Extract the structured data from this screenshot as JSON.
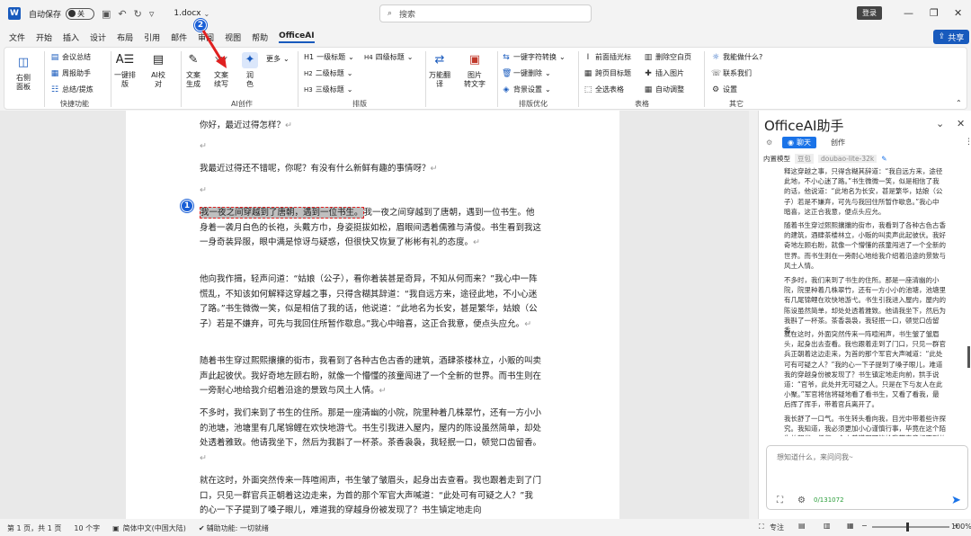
{
  "titlebar": {
    "logo": "W",
    "autosave_label": "自动保存",
    "autosave_state": "关",
    "doc_title": "1.docx",
    "search_placeholder": "搜索",
    "login_label": "登录"
  },
  "menu": [
    "文件",
    "开始",
    "插入",
    "设计",
    "布局",
    "引用",
    "邮件",
    "审阅",
    "视图",
    "帮助",
    "OfficeAI"
  ],
  "share_label": "共享",
  "ribbon": {
    "groups": [
      "快捷功能",
      "AI创作",
      "排版",
      "排版优化",
      "表格",
      "其它"
    ],
    "sidebar_btn": [
      "右侧",
      "面板"
    ],
    "meeting": "会议总结",
    "weekly": "周报助手",
    "summary": "总结/提炼",
    "one_click": [
      "一键排",
      "版"
    ],
    "ai_check": [
      "AI校",
      "对"
    ],
    "text_gen": [
      "文案",
      "生成"
    ],
    "continue_write": [
      "文案",
      "续写"
    ],
    "polish": [
      "润",
      "色"
    ],
    "more": "更多",
    "h1": "一级标题",
    "h2": "二级标题",
    "h3": "三级标题",
    "h4": "四级标题",
    "translate": [
      "万能翻",
      "译"
    ],
    "img_text": [
      "图片",
      "转文字"
    ],
    "char_conv": "一键字符转换",
    "one_delete": "一键删除",
    "bg_set": "背景设置",
    "front_cursor": "前面插光标",
    "cross_title": "跨页目标题",
    "select_table": "全选表格",
    "del_blank": "删除空白页",
    "insert_img": "插入图片",
    "auto_adjust": "自动调整",
    "what_can": "我能做什么?",
    "contact": "联系我们",
    "settings": "设置"
  },
  "document": {
    "p1": "你好，最近过得怎样？",
    "p2": "我最近过得还不错呢，你呢？有没有什么新鲜有趣的事情呀？",
    "p3_highlight": "我一夜之间穿越到了唐朝，遇到一位书生。",
    "p3_rest": "我一夜之间穿越到了唐朝，遇到一位书生。他身着一袭月白色的长袍，头戴方巾，身姿挺拔如松，眉眼间透着儒雅与清俊。书生看到我这一身奇装异服，眼中满是惊讶与疑惑，但很快又恢复了彬彬有礼的态度。",
    "p4": "他向我作揖，轻声问道：“姑娘（公子），看你着装甚是奇异，不知从何而来？”我心中一阵慌乱，不知该如何解释这穿越之事，只得含糊其辞道：“我自远方来，途径此地，不小心迷了路。”书生微微一笑，似是相信了我的话，他说道：“此地名为长安，甚是繁华，姑娘（公子）若是不嫌弃，可先与我回住所暂作歇息。”我心中暗喜，这正合我意，便点头应允。",
    "p5": "随着书生穿过熙熙攘攘的街市，我看到了各种古色古香的建筑，酒肆茶楼林立，小贩的叫卖声此起彼伏。我好奇地左顾右盼，就像一个懵懂的孩童闯进了一个全新的世界。而书生则在一旁耐心地给我介绍着沿途的景致与风土人情。",
    "p6": "不多时，我们来到了书生的住所。那是一座清幽的小院，院里种着几株翠竹，还有一方小小的池塘，池塘里有几尾锦鲤在欢快地游弋。书生引我进入屋内，屋内的陈设虽然简单，却处处透着雅致。他请我坐下，然后为我斟了一杯茶。茶香袅袅，我轻抿一口，顿觉口齿留香。",
    "p7": "就在这时，外面突然传来一阵喧闹声，书生皱了皱眉头，起身出去查看。我也跟着走到了门口，只见一群官兵正朝着这边走来，为首的那个军官大声喊道：“此处可有可疑之人？”我的心一下子提到了嗓子眼儿，难道我的穿越身份被发现了？书生镇定地走向"
  },
  "pane": {
    "title": "OfficeAI助手",
    "tab_chat": "聊天",
    "tab_create": "创作",
    "model_label": "内置模型",
    "model_a": "豆包",
    "model_b": "doubao-lite-32k",
    "msgs": [
      "释这穿越之事，只得含糊其辞道：“我自远方来，途径此地，不小心迷了路。”书生微微一笑，似是相信了我的话，他说道：“此地名为长安，甚是繁华，姑娘（公子）若是不嫌弃，可先与我回住所暂作歇息。”我心中暗喜，这正合我意，便点头应允。",
      "随着书生穿过熙熙攘攘的街市，我看到了各种古色古香的建筑，酒肆茶楼林立，小贩的叫卖声此起彼伏。我好奇地左顾右盼，就像一个懵懂的孩童闯进了一个全新的世界。而书生则在一旁耐心地给我介绍着沿途的景致与风土人情。",
      "不多时，我们来到了书生的住所。那是一座清幽的小院，院里种着几株翠竹，还有一方小小的池塘，池塘里有几尾锦鲤在欢快地游弋。书生引我进入屋内，屋内的陈设虽然简单，却处处透着雅致。他请我坐下，然后为我斟了一杯茶。茶香袅袅，我轻抿一口，顿觉口齿留香。",
      "就在这时，外面突然传来一阵喧闹声，书生皱了皱眉头，起身出去查看。我也跟着走到了门口，只见一群官兵正朝着这边走来，为首的那个军官大声喊道：“此处可有可疑之人？”我的心一下子提到了嗓子眼儿，难道我的穿越身份被发现了？书生镇定地走向前，拱手说道：“官爷，此处并无可疑之人。只是在下与友人在此小聚。”军官将信将疑地看了看书生，又看了看我，最后挥了挥手，带着官兵离开了。",
      "我长舒了一口气。书生转头看向我，目光中带着些许探究。我知道，我必须更加小心谨慎行事，毕竟在这个陌生的朝代，任何一个小差错都可能给我带来意想不到的麻烦。"
    ],
    "input_placeholder": "想知道什么，来问问我~",
    "counter": "0/131072"
  },
  "status": {
    "page": "第 1 页，共 1 页",
    "words": "10 个字",
    "lang": "简体中文(中国大陆)",
    "access": "辅助功能: 一切就绪",
    "focus": "专注",
    "zoom": "100%"
  },
  "badges": [
    "1",
    "2"
  ],
  "colors": {
    "accent": "#185abd",
    "badge": "#1a5fd6",
    "annotation": "#e02020"
  }
}
